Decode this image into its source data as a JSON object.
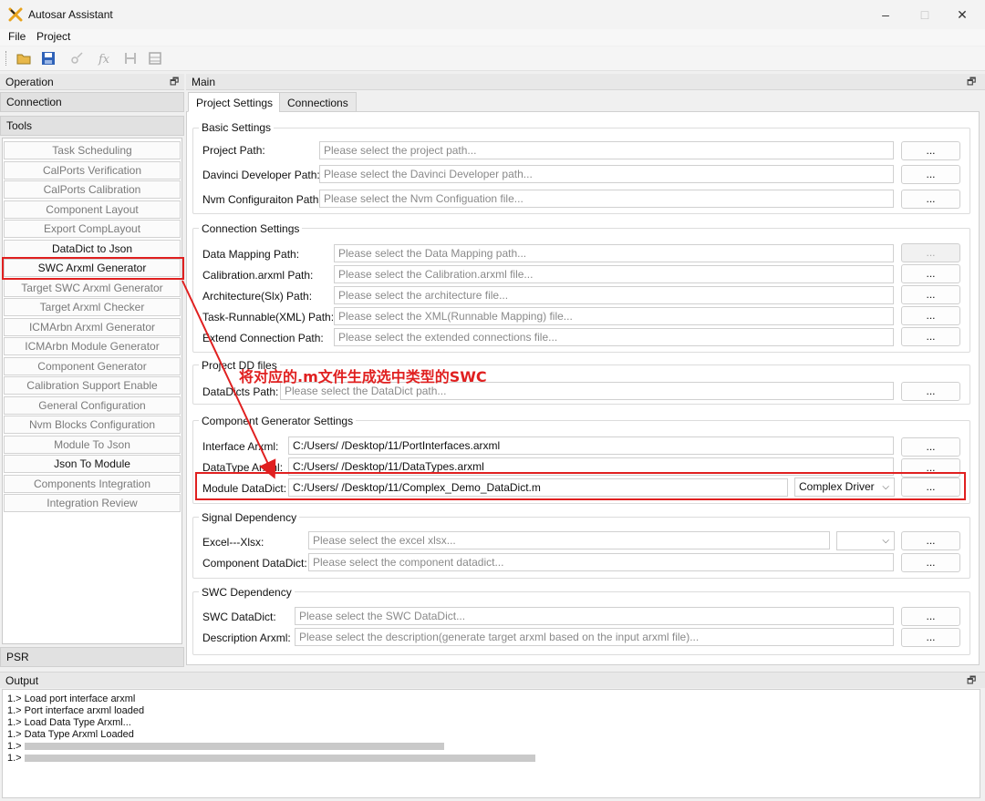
{
  "window": {
    "title": "Autosar Assistant",
    "controls": [
      "–",
      "□",
      "✕"
    ]
  },
  "menu": {
    "items": [
      "File",
      "Project"
    ]
  },
  "operation_panel": {
    "title": "Operation",
    "connection_label": "Connection",
    "tools_label": "Tools",
    "psr_label": "PSR",
    "tools": [
      {
        "label": "Task Scheduling",
        "active": false
      },
      {
        "label": "CalPorts Verification",
        "active": false
      },
      {
        "label": "CalPorts Calibration",
        "active": false
      },
      {
        "label": "Component Layout",
        "active": false
      },
      {
        "label": "Export CompLayout",
        "active": false
      },
      {
        "label": "DataDict to Json",
        "active": true
      },
      {
        "label": "SWC Arxml Generator",
        "active": true
      },
      {
        "label": "Target SWC Arxml Generator",
        "active": false
      },
      {
        "label": "Target Arxml Checker",
        "active": false
      },
      {
        "label": "ICMArbn Arxml Generator",
        "active": false
      },
      {
        "label": "ICMArbn Module Generator",
        "active": false
      },
      {
        "label": "Component Generator",
        "active": false
      },
      {
        "label": "Calibration Support Enable",
        "active": false
      },
      {
        "label": "General Configuration",
        "active": false
      },
      {
        "label": "Nvm Blocks Configuration",
        "active": false
      },
      {
        "label": "Module To Json",
        "active": false
      },
      {
        "label": "Json To Module",
        "active": true
      },
      {
        "label": "Components Integration",
        "active": false
      },
      {
        "label": "Integration Review",
        "active": false
      }
    ]
  },
  "main": {
    "title": "Main",
    "tabs": [
      "Project Settings",
      "Connections"
    ],
    "browse_label": "...",
    "basic": {
      "title": "Basic Settings",
      "fields": [
        {
          "label": "Project Path:",
          "placeholder": "Please select the project path..."
        },
        {
          "label": "Davinci Developer Path:",
          "placeholder": "Please select the Davinci Developer path..."
        },
        {
          "label": "Nvm Configuraiton Path:",
          "placeholder": "Please select the Nvm Configuation file..."
        }
      ]
    },
    "connection": {
      "title": "Connection Settings",
      "fields": [
        {
          "label": "Data Mapping Path:",
          "placeholder": "Please select the Data Mapping path..."
        },
        {
          "label": "Calibration.arxml Path:",
          "placeholder": "Please select the Calibration.arxml file..."
        },
        {
          "label": "Architecture(Slx) Path:",
          "placeholder": "Please select the architecture file..."
        },
        {
          "label": "Task-Runnable(XML) Path:",
          "placeholder": "Please select the XML(Runnable Mapping) file..."
        },
        {
          "label": "Extend Connection Path:",
          "placeholder": "Please select the extended connections file..."
        }
      ]
    },
    "project_dd": {
      "title": "Project DD files",
      "fields": [
        {
          "label": "DataDicts Path:",
          "placeholder": "Please select the DataDict path..."
        }
      ]
    },
    "component": {
      "title": "Component Generator Settings",
      "fields": [
        {
          "label": "Interface Arxml:",
          "value": "C:/Users/        /Desktop/11/PortInterfaces.arxml"
        },
        {
          "label": "DataType Arxml:",
          "value": "C:/Users/        /Desktop/11/DataTypes.arxml"
        },
        {
          "label": "Module DataDict:",
          "value": "C:/Users/        /Desktop/11/Complex_Demo_DataDict.m"
        }
      ],
      "type_select": "Complex Driver"
    },
    "signal": {
      "title": "Signal Dependency",
      "fields": [
        {
          "label": "Excel---Xlsx:",
          "placeholder": "Please select the excel xlsx..."
        },
        {
          "label": "Component DataDict:",
          "placeholder": "Please select the component datadict..."
        }
      ]
    },
    "swc": {
      "title": "SWC Dependency",
      "fields": [
        {
          "label": "SWC DataDict:",
          "placeholder": "Please select the SWC DataDict..."
        },
        {
          "label": "Description Arxml:",
          "placeholder": "Please select the description(generate target arxml based on the input arxml file)..."
        }
      ]
    }
  },
  "output": {
    "title": "Output",
    "lines": [
      "1.> Load port interface arxml",
      "1.> Port interface arxml loaded",
      "1.> Load Data Type Arxml...",
      "1.> Data Type Arxml Loaded",
      "1.>",
      "1.>"
    ]
  },
  "annotation": {
    "text": "将对应的.m文件生成选中类型的SWC",
    "color": "#e02020"
  }
}
